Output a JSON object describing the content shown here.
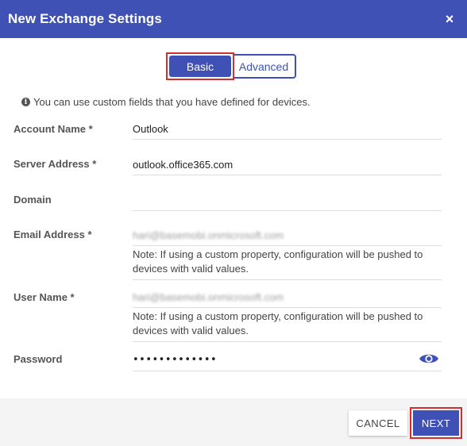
{
  "dialog": {
    "title": "New Exchange Settings",
    "close_glyph": "×"
  },
  "tabs": [
    {
      "label": "Basic",
      "selected": true
    },
    {
      "label": "Advanced",
      "selected": false
    }
  ],
  "info": {
    "icon": "info-icon",
    "text": "You can use custom fields that you have defined for devices."
  },
  "fields": {
    "account_name": {
      "label": "Account Name *",
      "value": "Outlook"
    },
    "server_address": {
      "label": "Server Address *",
      "value": "outlook.office365.com"
    },
    "domain": {
      "label": "Domain",
      "value": ""
    },
    "email_address": {
      "label": "Email Address *",
      "value": "hari@basemobi.onmicrosoft.com",
      "note": "Note: If using a custom property, configuration will be pushed to devices with valid values."
    },
    "user_name": {
      "label": "User Name *",
      "value": "hari@basemobi.onmicrosoft.com",
      "note": "Note: If using a custom property, configuration will be pushed to devices with valid values."
    },
    "password": {
      "label": "Password",
      "value": "•••••••••••••",
      "toggle_icon": "eye-icon"
    }
  },
  "footer": {
    "cancel_label": "CANCEL",
    "next_label": "NEXT"
  },
  "colors": {
    "primary": "#3f51b5",
    "highlight": "#d32f2f"
  }
}
